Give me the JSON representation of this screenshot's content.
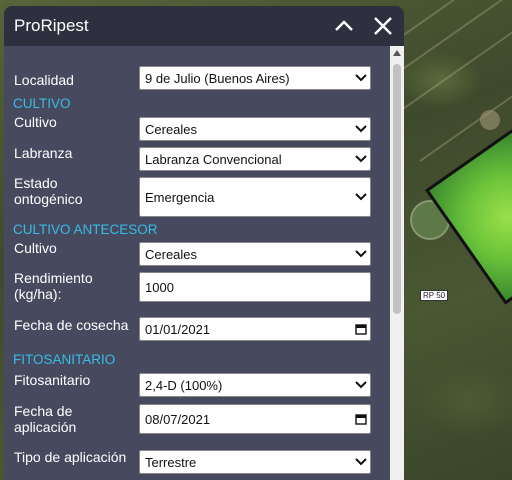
{
  "window": {
    "title": "ProRipest",
    "collapse_icon": "chevron-up-icon",
    "close_icon": "close-icon"
  },
  "map": {
    "road_label": "RP 50"
  },
  "form": {
    "localidad": {
      "label": "Localidad",
      "value": "9 de Julio (Buenos Aires)"
    },
    "cultivo_section": "CULTIVO",
    "cultivo": {
      "label": "Cultivo",
      "value": "Cereales"
    },
    "labranza": {
      "label": "Labranza",
      "value": "Labranza Convencional"
    },
    "estado": {
      "label_line1": "Estado",
      "label_line2": "ontogénico",
      "value": "Emergencia"
    },
    "antecesor_section": "CULTIVO ANTECESOR",
    "antecesor_cultivo": {
      "label": "Cultivo",
      "value": "Cereales"
    },
    "rendimiento": {
      "label_line1": "Rendimiento",
      "label_line2": "(kg/ha):",
      "value": "1000"
    },
    "fecha_cosecha": {
      "label": "Fecha de cosecha",
      "value": "01/01/2021"
    },
    "fitosanitario_section": "FITOSANITARIO",
    "fitosanitario": {
      "label": "Fitosanitario",
      "value": "2,4-D (100%)"
    },
    "fecha_aplicacion": {
      "label_line1": "Fecha de",
      "label_line2": "aplicación",
      "value": "08/07/2021"
    },
    "tipo_aplicacion": {
      "label": "Tipo de aplicación",
      "value": "Terrestre"
    }
  },
  "colors": {
    "panel_bg": "#474a5f",
    "titlebar_bg": "#2e3040",
    "section_accent": "#35bde6"
  }
}
